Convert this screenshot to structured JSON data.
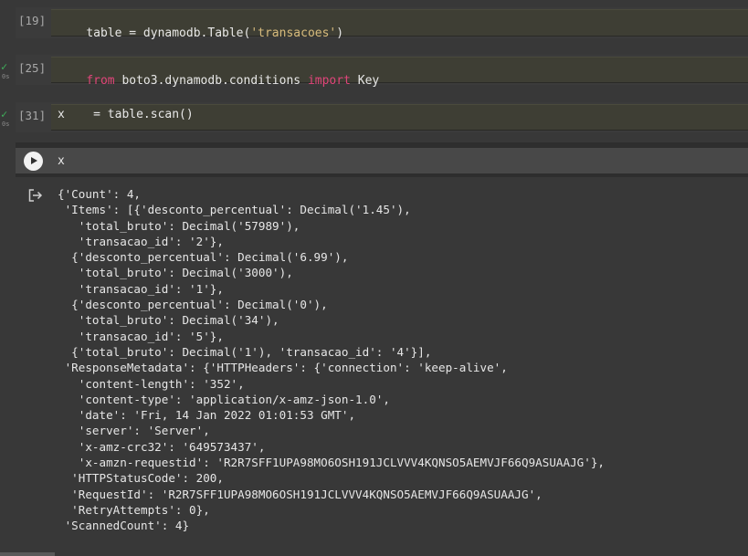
{
  "cells": [
    {
      "exec": "[19]",
      "status": "",
      "time": "",
      "code_parts": [
        "table = dynamodb.Table(",
        "'transacoes'",
        ")"
      ]
    },
    {
      "exec": "[25]",
      "status": "✓",
      "time": "0s",
      "code_parts": [
        "from",
        " boto3.dynamodb.conditions ",
        "import",
        " Key"
      ]
    },
    {
      "exec": "[31]",
      "status": "✓",
      "time": "0s",
      "code": "x    = table.scan()"
    },
    {
      "exec": "",
      "code": "x"
    }
  ],
  "output_lines": [
    "{'Count': 4,",
    " 'Items': [{'desconto_percentual': Decimal('1.45'),",
    "   'total_bruto': Decimal('57989'),",
    "   'transacao_id': '2'},",
    "  {'desconto_percentual': Decimal('6.99'),",
    "   'total_bruto': Decimal('3000'),",
    "   'transacao_id': '1'},",
    "  {'desconto_percentual': Decimal('0'),",
    "   'total_bruto': Decimal('34'),",
    "   'transacao_id': '5'},",
    "  {'total_bruto': Decimal('1'), 'transacao_id': '4'}],",
    " 'ResponseMetadata': {'HTTPHeaders': {'connection': 'keep-alive',",
    "   'content-length': '352',",
    "   'content-type': 'application/x-amz-json-1.0',",
    "   'date': 'Fri, 14 Jan 2022 01:01:53 GMT',",
    "   'server': 'Server',",
    "   'x-amz-crc32': '649573437',",
    "   'x-amzn-requestid': 'R2R7SFF1UPA98MO6OSH191JCLVVV4KQNSO5AEMVJF66Q9ASUAAJG'},",
    "  'HTTPStatusCode': 200,",
    "  'RequestId': 'R2R7SFF1UPA98MO6OSH191JCLVVV4KQNSO5AEMVJF66Q9ASUAAJG',",
    "  'RetryAttempts': 0},",
    " 'ScannedCount': 4}"
  ],
  "icons": {
    "run": "play-icon",
    "output": "output-redirect-icon",
    "status": "check-icon"
  },
  "colors": {
    "background": "#383838",
    "keyword": "#e0457b",
    "string": "#d7ba7d",
    "check": "#3fae5a"
  }
}
